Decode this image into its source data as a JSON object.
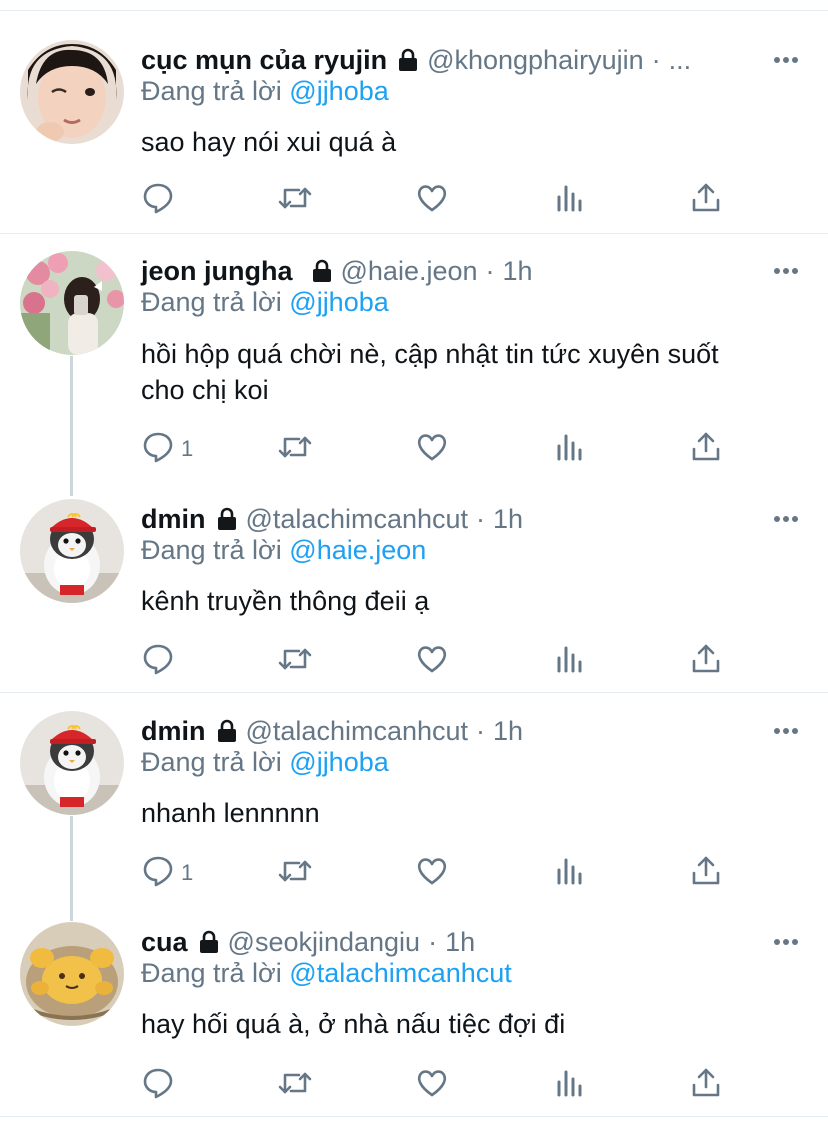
{
  "reply_prefix": "Đang trả lời",
  "tweets": [
    {
      "name": "cục mụn của ryujin",
      "handle": "@khongphairyujin",
      "sep": "·",
      "time": "...",
      "reply_to": "@jjhoba",
      "text": "sao hay nói xui quá à",
      "reply_count": ""
    },
    {
      "name": "jeon jungha",
      "handle": "@haie.jeon",
      "sep": "·",
      "time": "1h",
      "reply_to": "@jjhoba",
      "text": "hồi hộp quá chời nè, cập nhật tin tức xuyên suốt cho chị koi",
      "reply_count": "1"
    },
    {
      "name": "dmin",
      "handle": "@talachimcanhcut",
      "sep": "·",
      "time": "1h",
      "reply_to": "@haie.jeon",
      "text": "kênh truyền thông đeii ạ",
      "reply_count": ""
    },
    {
      "name": "dmin",
      "handle": "@talachimcanhcut",
      "sep": "·",
      "time": "1h",
      "reply_to": "@jjhoba",
      "text": "nhanh lennnnn",
      "reply_count": "1"
    },
    {
      "name": "cua",
      "handle": "@seokjindangiu",
      "sep": "·",
      "time": "1h",
      "reply_to": "@talachimcanhcut",
      "text": "hay hối quá à, ở nhà nấu tiệc đợi đi",
      "reply_count": ""
    }
  ],
  "icons": {
    "reply": "reply-icon",
    "retweet": "retweet-icon",
    "like": "like-icon",
    "analytics": "analytics-icon",
    "share": "share-icon",
    "more": "more-icon",
    "lock": "lock-icon"
  },
  "colors": {
    "link": "#1da1f2",
    "secondary": "#657786",
    "divider": "#e6ecf0"
  }
}
